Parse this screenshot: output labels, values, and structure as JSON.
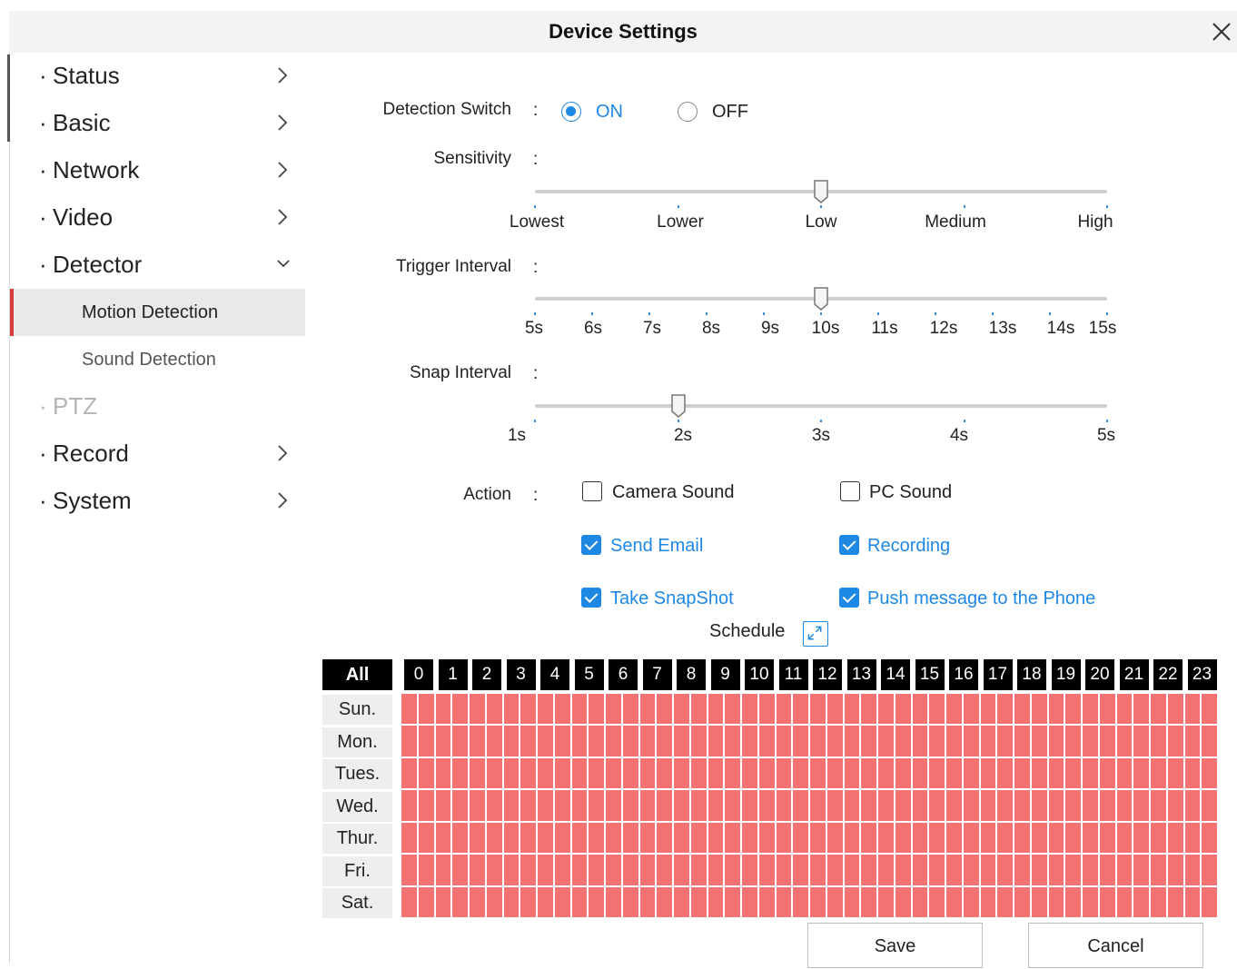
{
  "window": {
    "title": "Device Settings"
  },
  "sidebar": {
    "items": [
      {
        "label": "Status",
        "dot": "·",
        "chevron": "right"
      },
      {
        "label": "Basic",
        "dot": "·",
        "chevron": "right"
      },
      {
        "label": "Network",
        "dot": "·",
        "chevron": "right"
      },
      {
        "label": "Video",
        "dot": "·",
        "chevron": "right"
      },
      {
        "label": "Detector",
        "dot": "·",
        "chevron": "down"
      }
    ],
    "subitems": [
      {
        "label": "Motion Detection",
        "active": true
      },
      {
        "label": "Sound Detection",
        "active": false
      }
    ],
    "items2": [
      {
        "label": "PTZ",
        "dot": "·",
        "disabled": true
      },
      {
        "label": "Record",
        "dot": "·",
        "chevron": "right"
      },
      {
        "label": "System",
        "dot": "·",
        "chevron": "right"
      }
    ]
  },
  "form": {
    "colon": ":",
    "detection_switch": {
      "label": "Detection Switch",
      "on_label": "ON",
      "off_label": "OFF",
      "value": "ON"
    },
    "sensitivity": {
      "label": "Sensitivity",
      "options": [
        "Lowest",
        "Lower",
        "Low",
        "Medium",
        "High"
      ],
      "value": "Low"
    },
    "trigger_interval": {
      "label": "Trigger Interval",
      "options": [
        "5s",
        "6s",
        "7s",
        "8s",
        "9s",
        "10s",
        "11s",
        "12s",
        "13s",
        "14s",
        "15s"
      ],
      "value": "10s"
    },
    "snap_interval": {
      "label": "Snap Interval",
      "options": [
        "1s",
        "2s",
        "3s",
        "4s",
        "5s"
      ],
      "value": "2s"
    },
    "action": {
      "label": "Action",
      "options": [
        {
          "label": "Camera Sound",
          "checked": false
        },
        {
          "label": "PC Sound",
          "checked": false
        },
        {
          "label": "Send Email",
          "checked": true
        },
        {
          "label": "Recording",
          "checked": true
        },
        {
          "label": "Take SnapShot",
          "checked": true
        },
        {
          "label": "Push message to the Phone",
          "checked": true
        }
      ]
    }
  },
  "schedule": {
    "title": "Schedule",
    "all_label": "All",
    "hours": [
      "0",
      "1",
      "2",
      "3",
      "4",
      "5",
      "6",
      "7",
      "8",
      "9",
      "10",
      "11",
      "12",
      "13",
      "14",
      "15",
      "16",
      "17",
      "18",
      "19",
      "20",
      "21",
      "22",
      "23"
    ],
    "days": [
      "Sun.",
      "Mon.",
      "Tues.",
      "Wed.",
      "Thur.",
      "Fri.",
      "Sat."
    ],
    "all_selected": true,
    "selected_color": "#f47272"
  },
  "buttons": {
    "save": "Save",
    "cancel": "Cancel"
  },
  "colors": {
    "accent": "#1e88e5",
    "active_marker": "#d63a3a"
  }
}
